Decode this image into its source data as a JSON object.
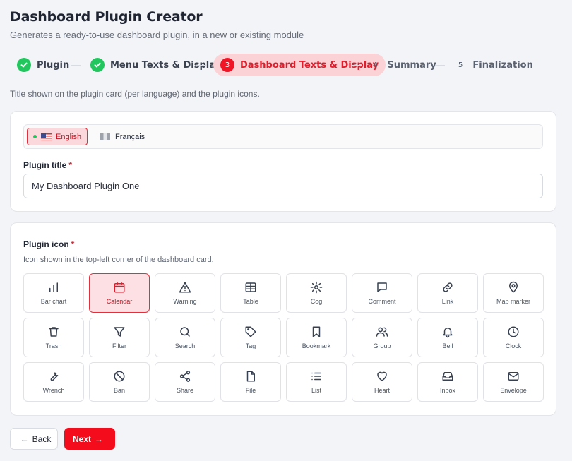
{
  "header": {
    "title": "Dashboard Plugin Creator",
    "subtitle": "Generates a ready-to-use dashboard plugin, in a new or existing module"
  },
  "stepper": {
    "steps": [
      {
        "label": "Plugin",
        "status": "done"
      },
      {
        "label": "Menu Texts & Display",
        "status": "done"
      },
      {
        "label": "Dashboard Texts & Display",
        "status": "active",
        "number": "3"
      },
      {
        "label": "Summary",
        "status": "pending",
        "number": "4"
      },
      {
        "label": "Finalization",
        "status": "pending",
        "number": "5"
      }
    ]
  },
  "hint": "Title shown on the plugin card (per language) and the plugin icons.",
  "languages": {
    "active": "English",
    "other": "Français"
  },
  "title_field": {
    "label": "Plugin title",
    "required_mark": "*",
    "value": "My Dashboard Plugin One"
  },
  "icon_field": {
    "label": "Plugin icon",
    "required_mark": "*",
    "help": "Icon shown in the top-left corner of the dashboard card.",
    "selected": "Calendar",
    "icons": [
      {
        "label": "Bar chart",
        "icon": "bar-chart-icon"
      },
      {
        "label": "Calendar",
        "icon": "calendar-icon"
      },
      {
        "label": "Warning",
        "icon": "warning-icon"
      },
      {
        "label": "Table",
        "icon": "table-icon"
      },
      {
        "label": "Cog",
        "icon": "cog-icon"
      },
      {
        "label": "Comment",
        "icon": "comment-icon"
      },
      {
        "label": "Link",
        "icon": "link-icon"
      },
      {
        "label": "Map marker",
        "icon": "map-marker-icon"
      },
      {
        "label": "Trash",
        "icon": "trash-icon"
      },
      {
        "label": "Filter",
        "icon": "filter-icon"
      },
      {
        "label": "Search",
        "icon": "search-icon"
      },
      {
        "label": "Tag",
        "icon": "tag-icon"
      },
      {
        "label": "Bookmark",
        "icon": "bookmark-icon"
      },
      {
        "label": "Group",
        "icon": "group-icon"
      },
      {
        "label": "Bell",
        "icon": "bell-icon"
      },
      {
        "label": "Clock",
        "icon": "clock-icon"
      },
      {
        "label": "Wrench",
        "icon": "wrench-icon"
      },
      {
        "label": "Ban",
        "icon": "ban-icon"
      },
      {
        "label": "Share",
        "icon": "share-icon"
      },
      {
        "label": "File",
        "icon": "file-icon"
      },
      {
        "label": "List",
        "icon": "list-icon"
      },
      {
        "label": "Heart",
        "icon": "heart-icon"
      },
      {
        "label": "Inbox",
        "icon": "inbox-icon"
      },
      {
        "label": "Envelope",
        "icon": "envelope-icon"
      }
    ]
  },
  "footer": {
    "back_label": "Back",
    "next_label": "Next"
  },
  "colors": {
    "accent": "#f40c1c",
    "success": "#22c55e",
    "active_bg": "#fbd2d6"
  }
}
